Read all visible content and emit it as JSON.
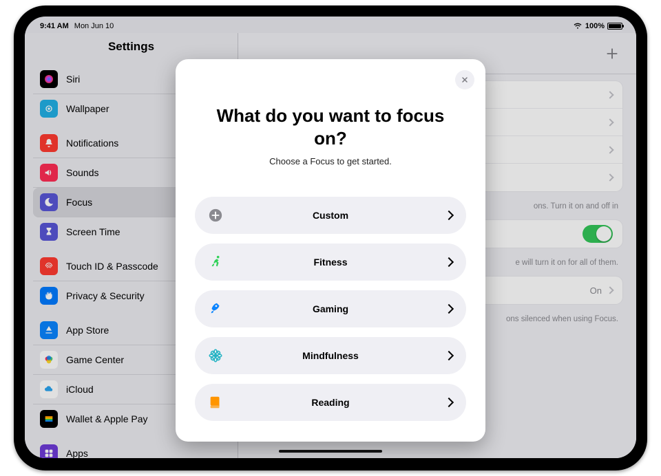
{
  "status": {
    "time": "9:41 AM",
    "date": "Mon Jun 10",
    "battery": "100%"
  },
  "sidebar": {
    "title": "Settings",
    "groups": [
      [
        {
          "label": "Siri",
          "icon": "siri",
          "bg": "#000000"
        },
        {
          "label": "Wallpaper",
          "icon": "wallpaper",
          "bg": "#22b0e5"
        }
      ],
      [
        {
          "label": "Notifications",
          "icon": "bell",
          "bg": "#ff3b30"
        },
        {
          "label": "Sounds",
          "icon": "volume",
          "bg": "#ff2d55"
        },
        {
          "label": "Focus",
          "icon": "moon",
          "bg": "#5856d6",
          "selected": true
        },
        {
          "label": "Screen Time",
          "icon": "hourglass",
          "bg": "#5856d6"
        }
      ],
      [
        {
          "label": "Touch ID & Passcode",
          "icon": "touchid",
          "bg": "#ff3b30"
        },
        {
          "label": "Privacy & Security",
          "icon": "hand",
          "bg": "#007aff"
        }
      ],
      [
        {
          "label": "App Store",
          "icon": "appstore",
          "bg": "#0a84ff"
        },
        {
          "label": "Game Center",
          "icon": "gamecenter",
          "bg": "#ffffff"
        },
        {
          "label": "iCloud",
          "icon": "icloud",
          "bg": "#ffffff"
        },
        {
          "label": "Wallet & Apple Pay",
          "icon": "wallet",
          "bg": "#000000"
        }
      ],
      [
        {
          "label": "Apps",
          "icon": "apps",
          "bg": "#6e3bd8"
        }
      ]
    ]
  },
  "detail": {
    "footnote1": "ons. Turn it on and off in",
    "footnote2": "e will turn it on for all of them.",
    "status_value": "On",
    "footnote3": "ons silenced when using Focus."
  },
  "modal": {
    "title": "What do you want to focus on?",
    "subtitle": "Choose a Focus to get started.",
    "options": [
      {
        "label": "Custom",
        "icon": "plus-circle",
        "color": "#8a8a90"
      },
      {
        "label": "Fitness",
        "icon": "runner",
        "color": "#30d158"
      },
      {
        "label": "Gaming",
        "icon": "rocket",
        "color": "#0a84ff"
      },
      {
        "label": "Mindfulness",
        "icon": "flower",
        "color": "#27b4c4"
      },
      {
        "label": "Reading",
        "icon": "book",
        "color": "#ff9500"
      }
    ]
  }
}
